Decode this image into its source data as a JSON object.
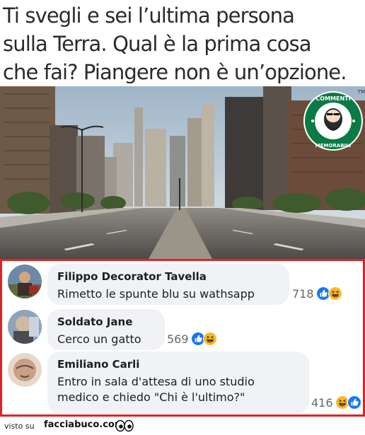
{
  "headline": {
    "line1": "Ti svegli e sei l’ultima persona",
    "line2": "sulla Terra. Qual è la prima cosa",
    "line3": "che fai? Piangere non è un’opzione."
  },
  "photo": {
    "description_icon": "empty-city-street-photo"
  },
  "badge": {
    "top_text": "COMMENTI",
    "bottom_text": "MEMORABILI",
    "tm": "TM",
    "icon": "bearded-man-logo"
  },
  "comments": [
    {
      "author": "Filippo Decorator Tavella",
      "text": "Rimetto le spunte blu su wathsapp",
      "count": "718",
      "reactions": [
        "like",
        "haha"
      ]
    },
    {
      "author": "Soldato Jane",
      "text": "Cerco un gatto",
      "count": "569",
      "reactions": [
        "like",
        "haha"
      ]
    },
    {
      "author": "Emiliano Carli",
      "text_line1": "Entro in sala d'attesa di uno studio",
      "text_line2": "medico e chiedo \"Chi è l'ultimo?\"",
      "count": "416",
      "reactions": [
        "haha",
        "like"
      ]
    }
  ],
  "footer": {
    "visto": "visto su",
    "site": "facciabuco.com"
  },
  "colors": {
    "frame": "#e02228",
    "bubble": "#f0f2f5",
    "like": "#1877f2",
    "haha": "#f7b928",
    "badge_green": "#0b7a45"
  }
}
